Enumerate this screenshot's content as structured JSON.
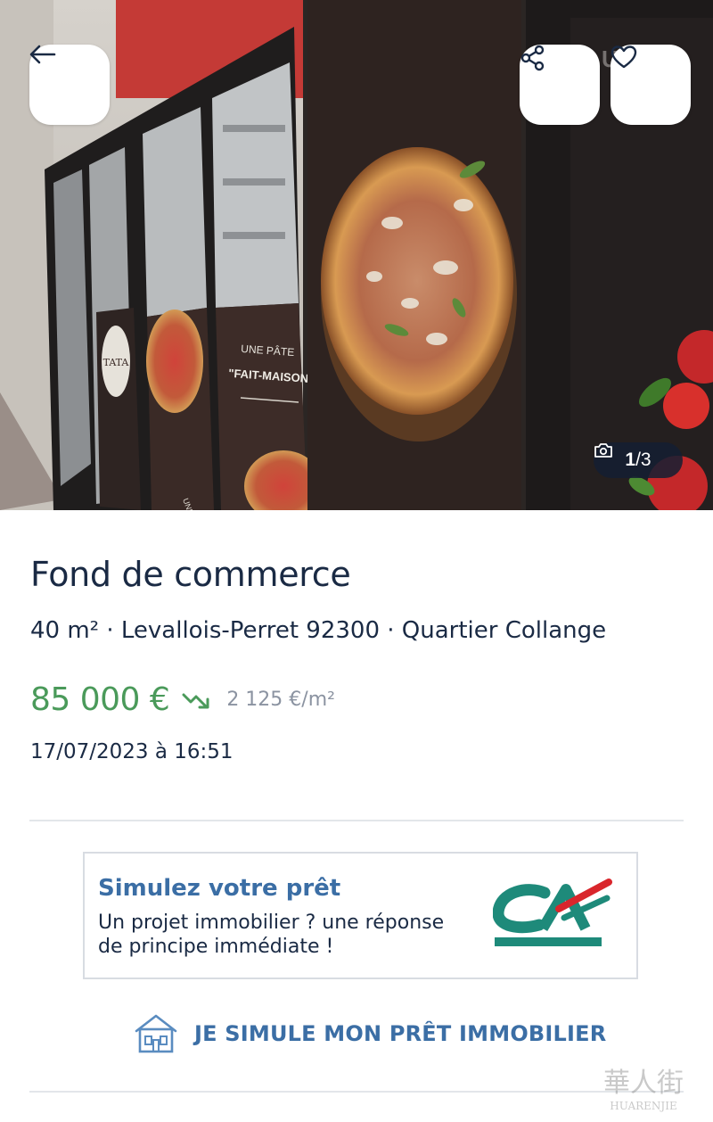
{
  "header": {
    "back_icon": "arrow-left-icon",
    "share_icon": "share-icon",
    "favorite_icon": "heart-icon",
    "photo_counter": {
      "camera_icon": "camera-icon",
      "current": "1",
      "total": "/3"
    }
  },
  "photo": {
    "sign_line1": "UNE PÂTE",
    "sign_line2": "\"FAIT-MAISON\"",
    "sign_small": "UNE PIZZA TRADITIONNELLE",
    "brand_mark": "TATA"
  },
  "listing": {
    "title": "Fond de commerce",
    "subtitle": "40 m² · Levallois-Perret 92300 · Quartier Collange",
    "price": "85 000 €",
    "price_per_m2": "2 125 €/m²",
    "date": "17/07/2023 à 16:51"
  },
  "ad": {
    "title": "Simulez votre prêt",
    "text": "Un projet immobilier ? une réponse de principe immédiate !",
    "logo": "CA"
  },
  "cta": {
    "icon": "house-icon",
    "label": "JE SIMULE MON PRÊT IMMOBILIER"
  },
  "watermark": {
    "cn": "華人街",
    "en": "HUARENJIE"
  },
  "colors": {
    "price_green": "#4a9a5a",
    "link_blue": "#3b6ea5",
    "text_dark": "#1a2a44",
    "ca_green": "#1e8a7a",
    "ca_red": "#d9262c"
  }
}
